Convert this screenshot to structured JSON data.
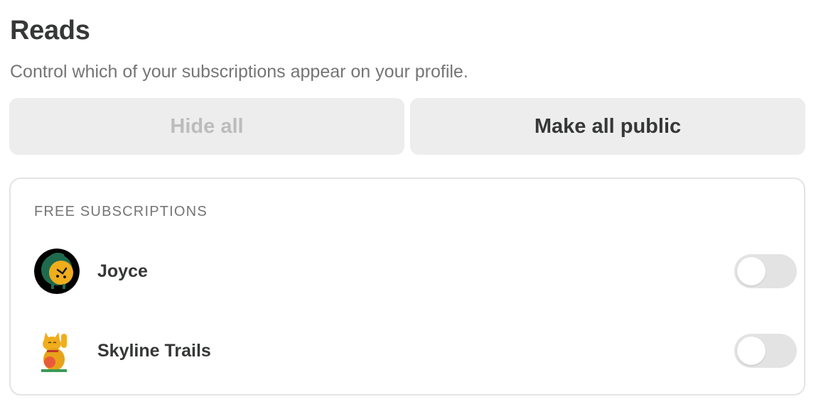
{
  "header": {
    "title": "Reads",
    "subtitle": "Control which of your subscriptions appear on your profile."
  },
  "actions": {
    "hide_all_label": "Hide all",
    "make_all_public_label": "Make all public"
  },
  "free_subscriptions": {
    "section_label": "FREE SUBSCRIPTIONS",
    "items": [
      {
        "name": "Joyce",
        "icon": "alarm-clock-avatar",
        "public": false
      },
      {
        "name": "Skyline Trails",
        "icon": "lucky-cat-avatar",
        "public": false
      }
    ]
  },
  "colors": {
    "button_bg": "#ededed",
    "disabled_text": "#bcbcbc",
    "toggle_off": "#e3e3e3"
  }
}
